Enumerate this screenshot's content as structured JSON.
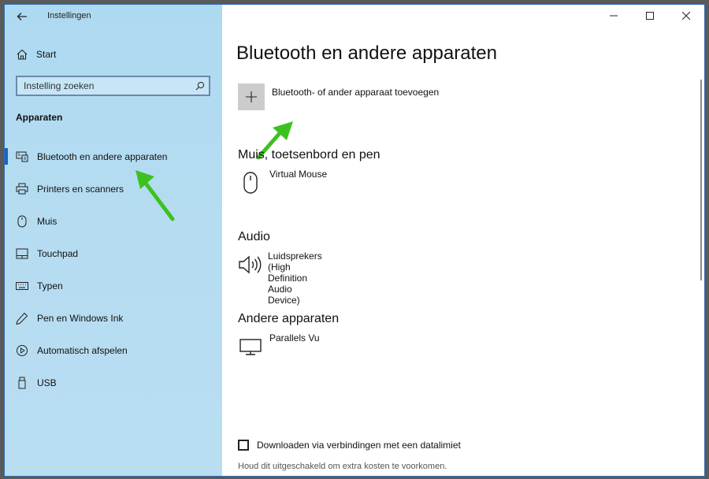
{
  "window": {
    "app_title": "Instellingen",
    "controls": {
      "minimize": "—",
      "maximize": "☐",
      "close": "✕"
    }
  },
  "sidebar": {
    "home_label": "Start",
    "search_placeholder": "Instelling zoeken",
    "section_title": "Apparaten",
    "items": [
      {
        "label": "Bluetooth en andere apparaten",
        "icon": "bluetooth-devices-icon",
        "active": true
      },
      {
        "label": "Printers en scanners",
        "icon": "printer-icon",
        "active": false
      },
      {
        "label": "Muis",
        "icon": "mouse-icon",
        "active": false
      },
      {
        "label": "Touchpad",
        "icon": "touchpad-icon",
        "active": false
      },
      {
        "label": "Typen",
        "icon": "keyboard-icon",
        "active": false
      },
      {
        "label": "Pen en Windows Ink",
        "icon": "pen-icon",
        "active": false
      },
      {
        "label": "Automatisch afspelen",
        "icon": "autoplay-icon",
        "active": false
      },
      {
        "label": "USB",
        "icon": "usb-icon",
        "active": false
      }
    ]
  },
  "main": {
    "title": "Bluetooth en andere apparaten",
    "add_device_label": "Bluetooth- of ander apparaat toevoegen",
    "groups": [
      {
        "title": "Muis, toetsenbord en pen",
        "devices": [
          {
            "name": "Virtual Mouse",
            "icon": "mouse-icon"
          }
        ]
      },
      {
        "title": "Audio",
        "devices": [
          {
            "name": "Luidsprekers (High Definition Audio Device)",
            "icon": "speaker-icon"
          }
        ]
      },
      {
        "title": "Andere apparaten",
        "devices": [
          {
            "name": "Parallels Vu",
            "icon": "monitor-icon"
          }
        ]
      }
    ],
    "metered_checkbox_label": "Downloaden via verbindingen met een datalimiet",
    "metered_checked": false,
    "metered_note": "Houd dit uitgeschakeld om extra kosten te voorkomen."
  },
  "colors": {
    "accent": "#1a63c9",
    "annotation_arrow": "#3cc21f",
    "sidebar_bg": "#b3dbf1"
  }
}
